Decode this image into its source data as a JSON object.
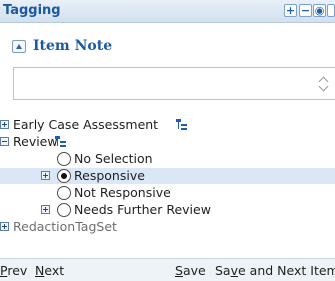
{
  "panel": {
    "title": "Tagging",
    "title_buttons": [
      "+",
      "−",
      "◉",
      "⤢"
    ]
  },
  "note": {
    "title": "Item Note",
    "value": ""
  },
  "tree": {
    "items": [
      {
        "label": "Early Case Assessment"
      },
      {
        "label": "Review"
      },
      {
        "label": "No Selection"
      },
      {
        "label": "Responsive"
      },
      {
        "label": "Not Responsive"
      },
      {
        "label": "Needs Further Review"
      },
      {
        "label": "RedactionTagSet"
      }
    ]
  },
  "footer": {
    "prev": {
      "mnemonic": "P",
      "rest": "rev"
    },
    "next": {
      "mnemonic": "N",
      "rest": "ext"
    },
    "save": {
      "mnemonic": "S",
      "rest": "ave"
    },
    "save_next": {
      "before": "Sa",
      "mnemonic": "v",
      "rest": "e and Next Item"
    }
  },
  "colors": {
    "accent": "#1b5aa3",
    "selected_row": "#d9e7f7",
    "titlebar": "#dbe6f2"
  }
}
